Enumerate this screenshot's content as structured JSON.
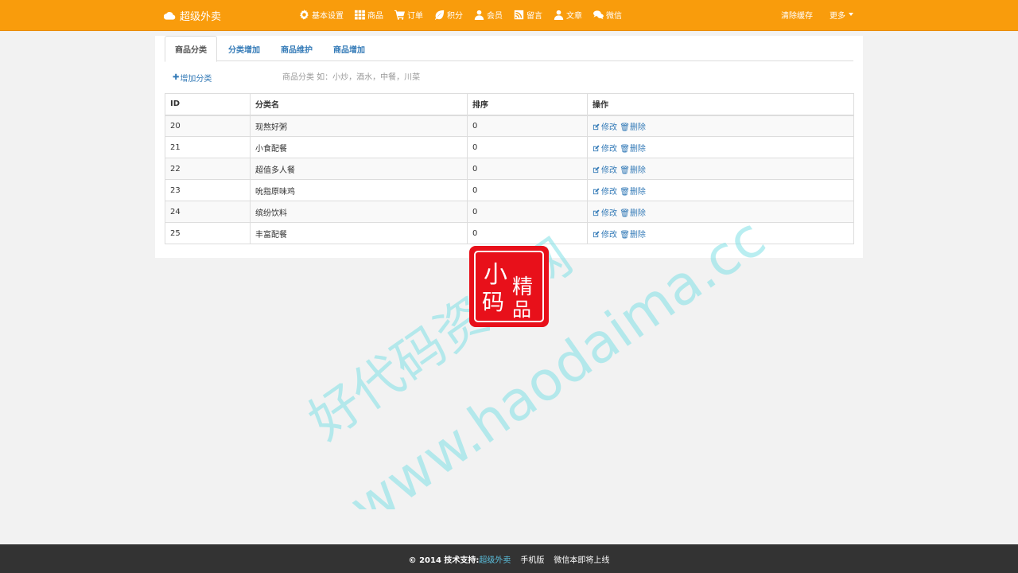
{
  "navbar": {
    "brand": "超级外卖",
    "items": [
      {
        "label": "基本设置",
        "icon": "gear-icon"
      },
      {
        "label": "商品",
        "icon": "grid-icon"
      },
      {
        "label": "订单",
        "icon": "cart-icon"
      },
      {
        "label": "积分",
        "icon": "leaf-icon"
      },
      {
        "label": "会员",
        "icon": "user-icon"
      },
      {
        "label": "留言",
        "icon": "rss-icon"
      },
      {
        "label": "文章",
        "icon": "user-icon"
      },
      {
        "label": "微信",
        "icon": "comments-icon"
      }
    ],
    "clear_cache": "清除缓存",
    "more": "更多"
  },
  "tabs": [
    "商品分类",
    "分类增加",
    "商品维护",
    "商品增加"
  ],
  "add_category": "增加分类",
  "hint": "商品分类 如：小炒，酒水，中餐，川菜",
  "table": {
    "headers": [
      "ID",
      "分类名",
      "排序",
      "操作"
    ],
    "rows": [
      {
        "id": "20",
        "name": "现熬好粥",
        "sort": "0"
      },
      {
        "id": "21",
        "name": "小食配餐",
        "sort": "0"
      },
      {
        "id": "22",
        "name": "超值多人餐",
        "sort": "0"
      },
      {
        "id": "23",
        "name": "吮指原味鸡",
        "sort": "0"
      },
      {
        "id": "24",
        "name": "缤纷饮料",
        "sort": "0"
      },
      {
        "id": "25",
        "name": "丰富配餐",
        "sort": "0"
      }
    ],
    "edit_label": "修改",
    "delete_label": "删除"
  },
  "footer": {
    "copyright": "© 2014 技术支持:",
    "brand": "超级外卖",
    "mobile": "手机版",
    "wechat": "微信本即将上线"
  },
  "watermark": {
    "line1": "好代码资源网",
    "line2": "www.haodaima.cc",
    "stamp_chars": [
      "小",
      "精",
      "码",
      "品"
    ]
  },
  "colors": {
    "navbar": "#f99c0c",
    "link": "#337ab7",
    "footer": "#333333",
    "stamp": "#e8101a"
  }
}
